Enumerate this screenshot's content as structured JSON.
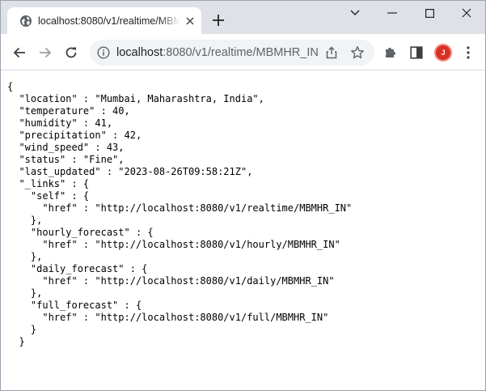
{
  "colors": {
    "tabstrip_bg": "#dee1e6",
    "omnibox_bg": "#f1f3f4",
    "avatar_bg": "#d93025",
    "icon": "#5f6368"
  },
  "tab": {
    "title": "localhost:8080/v1/realtime/MBMHR_IN",
    "favicon": "globe-icon"
  },
  "omnibox": {
    "url_host": "localhost",
    "url_rest": ":8080/v1/realtime/MBMHR_IN"
  },
  "profile": {
    "initial": "J"
  },
  "json_lines": [
    "{",
    "  \"location\" : \"Mumbai, Maharashtra, India\",",
    "  \"temperature\" : 40,",
    "  \"humidity\" : 41,",
    "  \"precipitation\" : 42,",
    "  \"wind_speed\" : 43,",
    "  \"status\" : \"Fine\",",
    "  \"last_updated\" : \"2023-08-26T09:58:21Z\",",
    "  \"_links\" : {",
    "    \"self\" : {",
    "      \"href\" : \"http://localhost:8080/v1/realtime/MBMHR_IN\"",
    "    },",
    "    \"hourly_forecast\" : {",
    "      \"href\" : \"http://localhost:8080/v1/hourly/MBMHR_IN\"",
    "    },",
    "    \"daily_forecast\" : {",
    "      \"href\" : \"http://localhost:8080/v1/daily/MBMHR_IN\"",
    "    },",
    "    \"full_forecast\" : {",
    "      \"href\" : \"http://localhost:8080/v1/full/MBMHR_IN\"",
    "    }",
    "  }",
    "}"
  ]
}
